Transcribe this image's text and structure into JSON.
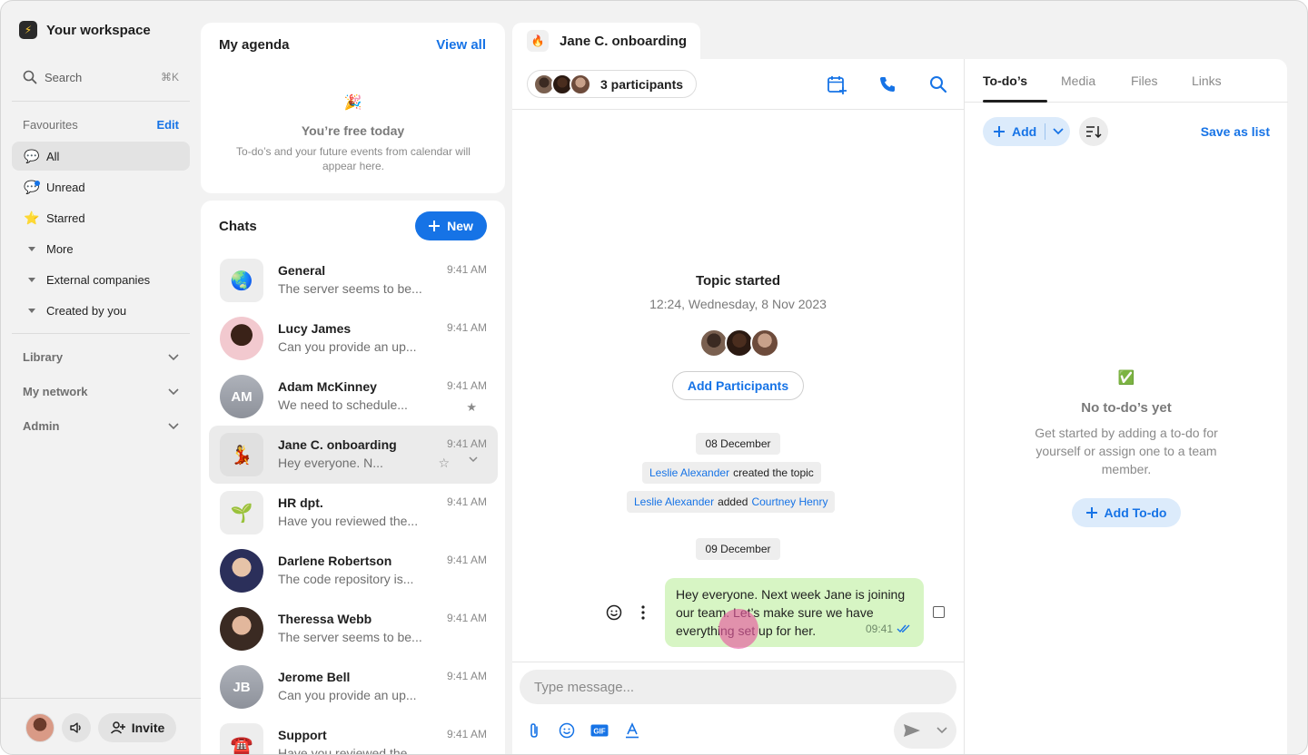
{
  "workspace": {
    "name": "Your workspace"
  },
  "search": {
    "label": "Search",
    "shortcut": "⌘K"
  },
  "favourites": {
    "heading": "Favourites",
    "edit_label": "Edit",
    "items": [
      {
        "label": "All",
        "icon": "speech-bubble-icon"
      },
      {
        "label": "Unread",
        "icon": "unread-bubble-icon"
      },
      {
        "label": "Starred",
        "icon": "star-icon"
      },
      {
        "label": "More",
        "icon": "caret-icon"
      },
      {
        "label": "External companies",
        "icon": "caret-icon"
      },
      {
        "label": "Created by you",
        "icon": "caret-icon"
      }
    ]
  },
  "groups": [
    "Library",
    "My network",
    "Admin"
  ],
  "bottom": {
    "invite_label": "Invite"
  },
  "agenda": {
    "title": "My agenda",
    "view_all": "View all",
    "empty_title": "You’re free today",
    "empty_desc": "To-do’s and your future events from calendar will appear here."
  },
  "chats": {
    "title": "Chats",
    "new_label": "New",
    "items": [
      {
        "name": "General",
        "preview": "The server seems to be...",
        "time": "9:41 AM"
      },
      {
        "name": "Lucy James",
        "preview": "Can you provide an up...",
        "time": "9:41 AM"
      },
      {
        "name": "Adam McKinney",
        "preview": "We need to schedule...",
        "time": "9:41 AM",
        "initials": "AM"
      },
      {
        "name": "Jane C. onboarding",
        "preview": "Hey everyone. N...",
        "time": "9:41 AM"
      },
      {
        "name": "HR dpt.",
        "preview": "Have you reviewed the...",
        "time": "9:41 AM"
      },
      {
        "name": "Darlene Robertson",
        "preview": "The code repository is...",
        "time": "9:41 AM"
      },
      {
        "name": "Theressa Webb",
        "preview": "The server seems to be...",
        "time": "9:41 AM"
      },
      {
        "name": "Jerome Bell",
        "preview": "Can you provide an up...",
        "time": "9:41 AM",
        "initials": "JB"
      },
      {
        "name": "Support",
        "preview": "Have you reviewed the...",
        "time": "9:41 AM"
      }
    ]
  },
  "conversation": {
    "tab_title": "Jane C. onboarding",
    "participants_label": "3 participants",
    "topic_title": "Topic started",
    "topic_date": "12:24, Wednesday, 8 Nov 2023",
    "add_participants": "Add Participants",
    "date1": "08 December",
    "event1": {
      "actor": "Leslie Alexander",
      "text": "created the topic"
    },
    "event2": {
      "actor": "Leslie Alexander",
      "text": "added",
      "target": "Courtney Henry"
    },
    "date2": "09 December",
    "message": {
      "text": "Hey everyone. Next week Jane is joining our team. Let’s make sure we have everything set up for her.",
      "time": "09:41"
    },
    "composer_placeholder": "Type message..."
  },
  "todos": {
    "tabs": [
      "To-do’s",
      "Media",
      "Files",
      "Links"
    ],
    "add_label": "Add",
    "save_as_list": "Save as list",
    "empty_title": "No to-do’s yet",
    "empty_desc": "Get started by adding a to-do for yourself or assign one to a team member.",
    "add_todo": "Add To-do"
  },
  "colors": {
    "accent": "#1673e6",
    "bubble": "#d7f5c4",
    "sidebar_bg": "#f2f2f2"
  }
}
